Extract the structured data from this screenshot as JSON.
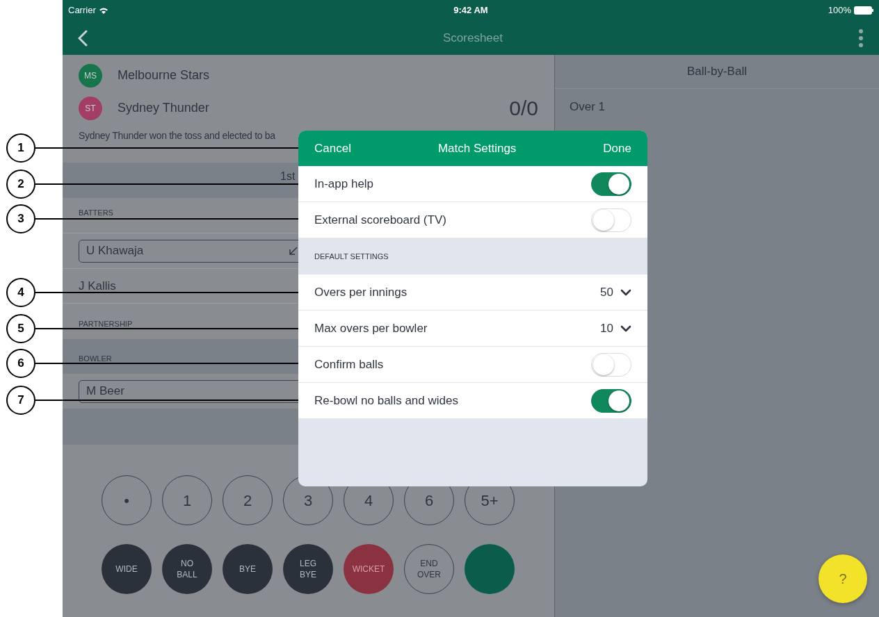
{
  "status_bar": {
    "carrier": "Carrier",
    "time": "9:42 AM",
    "battery": "100%"
  },
  "nav": {
    "title": "Scoresheet"
  },
  "teams": [
    {
      "abbr": "MS",
      "name": "Melbourne Stars",
      "color": "#17744b"
    },
    {
      "abbr": "ST",
      "name": "Sydney Thunder",
      "color": "#a23d66",
      "score": "0/0"
    }
  ],
  "toss_text": "Sydney Thunder won the toss and elected to ba",
  "innings_tab": "1st",
  "batters": {
    "label": "BATTERS",
    "players": [
      {
        "name": "U Khawaja",
        "kind": "field"
      },
      {
        "name": "J Kallis",
        "kind": "plain"
      }
    ]
  },
  "partnership": {
    "label": "PARTNERSHIP"
  },
  "bowler": {
    "label": "BOWLER",
    "name": "M Beer"
  },
  "run_buttons": [
    "•",
    "1",
    "2",
    "3",
    "4",
    "6",
    "5+"
  ],
  "extra_buttons": [
    {
      "kind": "dark",
      "label": "WIDE"
    },
    {
      "kind": "dark",
      "label": "NO BALL"
    },
    {
      "kind": "dark",
      "label": "BYE"
    },
    {
      "kind": "dark",
      "label": "LEG BYE"
    },
    {
      "kind": "danger",
      "label": "WICKET"
    },
    {
      "kind": "outline",
      "label": "END OVER"
    },
    {
      "kind": "accent"
    }
  ],
  "ball_by_ball": {
    "title": "Ball-by-Ball",
    "over": "Over 1"
  },
  "help_button": "?",
  "modal": {
    "cancel": "Cancel",
    "title": "Match Settings",
    "done": "Done",
    "rows": [
      {
        "kind": "toggle",
        "label": "In-app help",
        "on": true
      },
      {
        "kind": "toggle",
        "label": "External scoreboard (TV)",
        "on": false
      },
      {
        "kind": "section",
        "label": "DEFAULT SETTINGS"
      },
      {
        "kind": "select",
        "label": "Overs per innings",
        "value": "50"
      },
      {
        "kind": "select",
        "label": "Max overs per bowler",
        "value": "10"
      },
      {
        "kind": "toggle",
        "label": "Confirm balls",
        "on": false
      },
      {
        "kind": "toggle",
        "label": "Re-bowl no balls and wides",
        "on": true
      }
    ]
  },
  "callouts": [
    "1",
    "2",
    "3",
    "4",
    "5",
    "6",
    "7"
  ]
}
